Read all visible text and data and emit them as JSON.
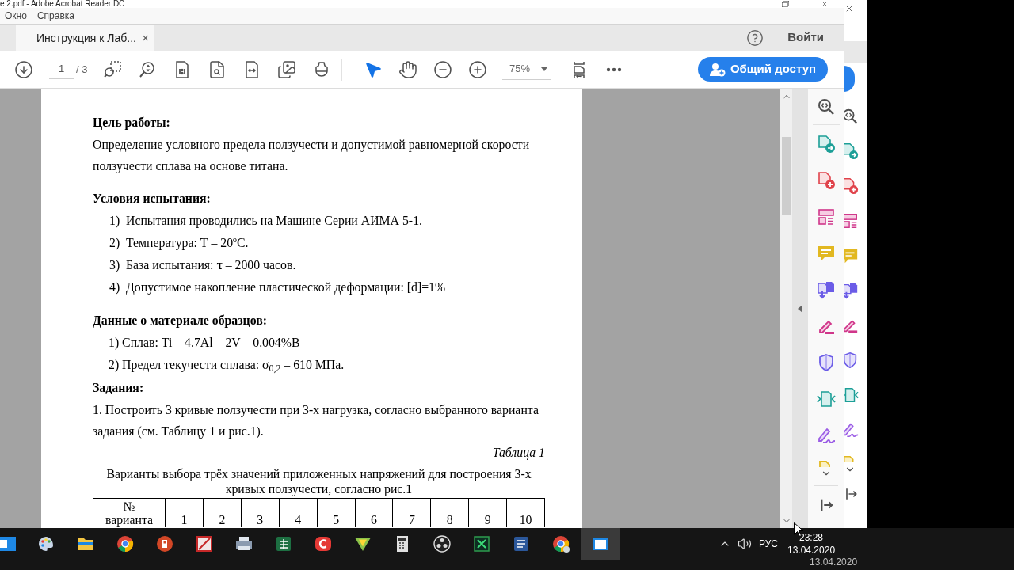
{
  "window": {
    "title": "e 2.pdf - Adobe Acrobat Reader DC"
  },
  "menu": [
    {
      "label": "Окно"
    },
    {
      "label": "Справка"
    }
  ],
  "tabs": [
    {
      "label": "Инструкция к Лаб...",
      "selected": true,
      "close": "×"
    }
  ],
  "header": {
    "signin": "Войти"
  },
  "toolbar": {
    "page": {
      "value": "1",
      "total": "/ 3"
    },
    "pointer_tools": [
      {
        "kind": "select",
        "selected": true
      },
      {
        "kind": "hand",
        "selected": false
      }
    ],
    "zoom": {
      "value": "75%"
    },
    "share": {
      "label": "Общий доступ"
    }
  },
  "document": {
    "blocks": [
      {
        "kind": "heading",
        "text": "Цель работы:"
      },
      {
        "kind": "paragraph",
        "text": "Определение условного предела ползучести и допустимой равномерной скорости ползучести сплава на основе титана."
      },
      {
        "kind": "heading",
        "text": "Условия испытания:"
      },
      {
        "kind": "list",
        "items": [
          {
            "number": "1)",
            "text": "Испытания проводились на Машине Серии АИМА 5-1."
          },
          {
            "number": "2)",
            "text": "Температура: Т – 20ºС."
          },
          {
            "number": "3)",
            "text": "База испытания: **τ** – 2000 часов."
          },
          {
            "number": "4)",
            "text": "Допустимое накопление пластической деформации: [d]=1%"
          }
        ]
      },
      {
        "kind": "heading",
        "text": "Данные о материале образцов:"
      },
      {
        "kind": "list_inline",
        "items": [
          {
            "text": "1) Сплав: Ti – 4.7Al – 2V – 0.004%B"
          },
          {
            "text": "2) Предел текучести сплава: σ$_{0,2}$ – 610 МПа."
          }
        ]
      },
      {
        "kind": "heading",
        "text": "Задания:"
      },
      {
        "kind": "paragraph",
        "text": "1. Построить 3 кривые ползучести при 3-х нагрузка, согласно выбранного варианта задания (см. Таблицу 1 и рис.1)."
      },
      {
        "kind": "caption",
        "text": "Таблица 1"
      },
      {
        "kind": "title",
        "text": "Варианты выбора трёх значений приложенных напряжений для построения 3-х кривых ползучести, согласно рис.1"
      },
      {
        "kind": "table",
        "header": [
          "№ варианта",
          "1",
          "2",
          "3",
          "4",
          "5",
          "6",
          "7",
          "8",
          "9",
          "10"
        ]
      }
    ]
  },
  "taskbar": {
    "apps": [
      {
        "kind": "tile",
        "selected": false
      },
      {
        "kind": "paint",
        "selected": false
      },
      {
        "kind": "explorer",
        "selected": false
      },
      {
        "kind": "chrome",
        "selected": false
      },
      {
        "kind": "powerpoint",
        "selected": false
      },
      {
        "kind": "picture",
        "selected": false
      },
      {
        "kind": "scanner",
        "selected": false
      },
      {
        "kind": "excel",
        "selected": false
      },
      {
        "kind": "screencast",
        "selected": false
      },
      {
        "kind": "triangle",
        "selected": false
      },
      {
        "kind": "calculator",
        "selected": false
      },
      {
        "kind": "obs",
        "selected": false
      },
      {
        "kind": "xmind",
        "selected": false
      },
      {
        "kind": "word",
        "selected": false
      },
      {
        "kind": "chrome_user",
        "selected": false
      },
      {
        "kind": "reader",
        "selected": true
      }
    ],
    "language": "РУС",
    "time": "23:28",
    "date": "13.04.2020",
    "ghost_date": "13.04.2020"
  }
}
